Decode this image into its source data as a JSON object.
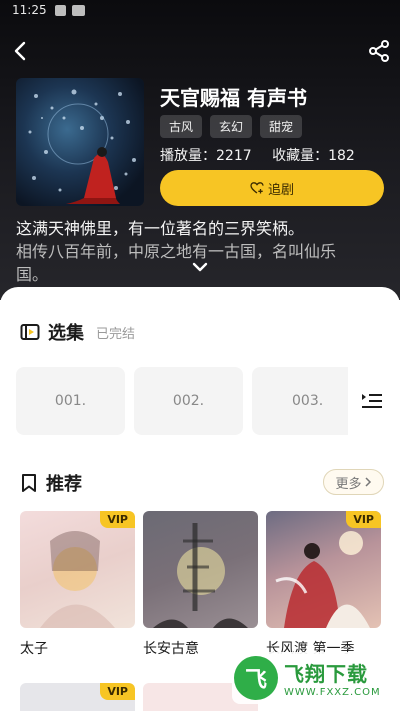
{
  "status_bar": {
    "time": "11:25"
  },
  "book": {
    "title": "天官赐福 有声书",
    "tags": [
      "古风",
      "玄幻",
      "甜宠"
    ],
    "play_count_label": "播放量：2217",
    "fav_count_label": "收藏量：182",
    "follow_label": "追剧",
    "description": {
      "line1": "这满天神佛里，有一位著名的三界笑柄。",
      "line2": "相传八百年前，中原之地有一古国，名叫仙乐",
      "line3": "国。"
    }
  },
  "episodes_section": {
    "title": "选集",
    "status": "已完结",
    "episodes": [
      "001.",
      "002.",
      "003."
    ]
  },
  "recommend_section": {
    "title": "推荐",
    "more_label": "更多",
    "items": [
      {
        "title": "太子",
        "badge": "VIP"
      },
      {
        "title": "长安古意",
        "badge": ""
      },
      {
        "title": "长风渡 第一季",
        "badge": "VIP"
      }
    ],
    "partial_items": [
      {
        "badge": "VIP"
      },
      {
        "badge": ""
      }
    ]
  },
  "watermark": {
    "logo": "飞",
    "main": "飞翔下载",
    "sub": "WWW.FXXZ.COM"
  },
  "colors": {
    "accent": "#f7c524",
    "hero_bg": "#1b1b20"
  },
  "icons": [
    "back-arrow-icon",
    "share-icon",
    "heart-plus-icon",
    "chevron-down-icon",
    "episodes-icon",
    "list-icon",
    "bookmark-icon",
    "chevron-right-icon"
  ]
}
